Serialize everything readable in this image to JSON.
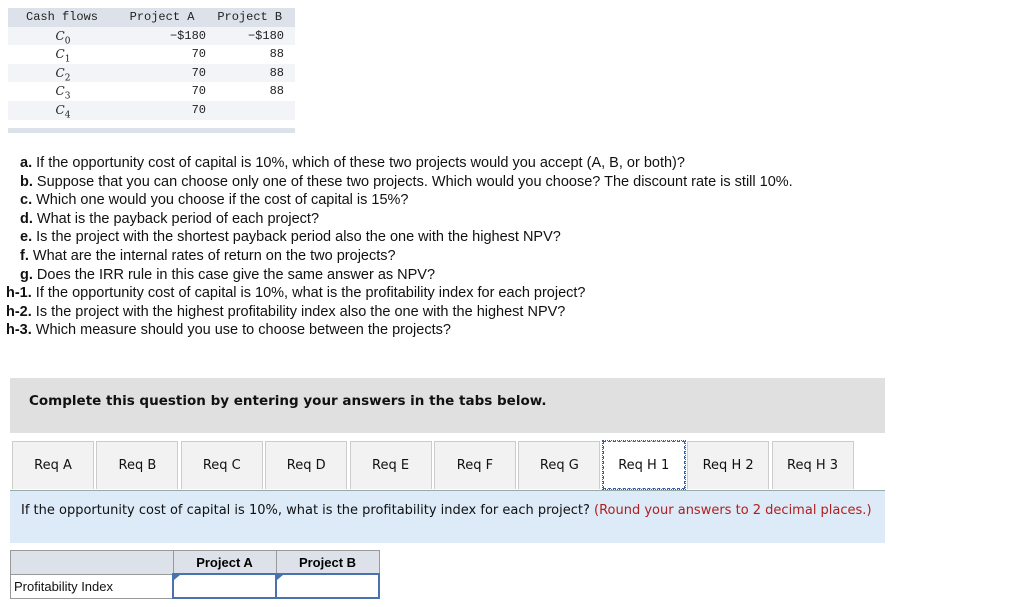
{
  "cash_flows": {
    "headers": [
      "Cash flows",
      "Project A",
      "Project B"
    ],
    "rows": [
      {
        "label": "C0",
        "a": "−$180",
        "b": "−$180"
      },
      {
        "label": "C1",
        "a": "70",
        "b": "88"
      },
      {
        "label": "C2",
        "a": "70",
        "b": "88"
      },
      {
        "label": "C3",
        "a": "70",
        "b": "88"
      },
      {
        "label": "C4",
        "a": "70",
        "b": ""
      }
    ]
  },
  "questions": [
    {
      "tag": "a.",
      "text": " If the opportunity cost of capital is 10%, which of these two projects would you accept (A, B, or both)?"
    },
    {
      "tag": "b.",
      "text": " Suppose that you can choose only one of these two projects. Which would you choose? The discount rate is still 10%."
    },
    {
      "tag": "c.",
      "text": " Which one would you choose if the cost of capital is 15%?"
    },
    {
      "tag": "d.",
      "text": " What is the payback period of each project?"
    },
    {
      "tag": "e.",
      "text": " Is the project with the shortest payback period also the one with the highest NPV?"
    },
    {
      "tag": "f.",
      "text": " What are the internal rates of return on the two projects?"
    },
    {
      "tag": "g.",
      "text": " Does the IRR rule in this case give the same answer as NPV?"
    },
    {
      "tag": "h-1.",
      "text": " If the opportunity cost of capital is 10%, what is the profitability index for each project?"
    },
    {
      "tag": "h-2.",
      "text": " Is the project with the highest profitability index also the one with the highest NPV?"
    },
    {
      "tag": "h-3.",
      "text": " Which measure should you use to choose between the projects?"
    }
  ],
  "instruction": "Complete this question by entering your answers in the tabs below.",
  "tabs": [
    "Req A",
    "Req B",
    "Req C",
    "Req D",
    "Req E",
    "Req F",
    "Req G",
    "Req H 1",
    "Req H 2",
    "Req H 3"
  ],
  "active_tab": "Req H 1",
  "panel": {
    "text": "If the opportunity cost of capital is 10%, what is the profitability index for each project? ",
    "hint": "(Round your answers to 2 decimal places.)"
  },
  "answer_table": {
    "headers": [
      "",
      "Project A",
      "Project B"
    ],
    "row_label": "Profitability Index",
    "values": [
      "",
      ""
    ]
  }
}
